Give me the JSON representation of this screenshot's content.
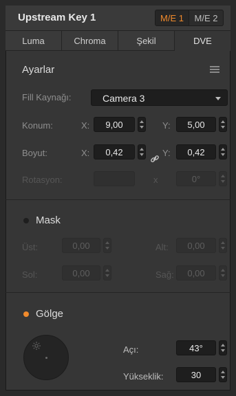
{
  "header": {
    "title": "Upstream Key 1",
    "me_tabs": [
      "M/E 1",
      "M/E 2"
    ]
  },
  "tabs": [
    "Luma",
    "Chroma",
    "Şekil",
    "DVE"
  ],
  "settings": {
    "title": "Ayarlar",
    "fill_label": "Fill Kaynağı:",
    "fill_value": "Camera 3",
    "position_label": "Konum:",
    "size_label": "Boyut:",
    "rotation_label": "Rotasyon:",
    "x_label": "X:",
    "y_label": "Y:",
    "x_dim_label": "x",
    "position_x": "9,00",
    "position_y": "5,00",
    "size_x": "0,42",
    "size_y": "0,42",
    "rotation_value": "0°"
  },
  "mask": {
    "title": "Mask",
    "top_label": "Üst:",
    "top_value": "0,00",
    "bottom_label": "Alt:",
    "bottom_value": "0,00",
    "left_label": "Sol:",
    "left_value": "0,00",
    "right_label": "Sağ:",
    "right_value": "0,00"
  },
  "shadow": {
    "title": "Gölge",
    "angle_label": "Açı:",
    "angle_value": "43°",
    "height_label": "Yükseklik:",
    "height_value": "30"
  },
  "colors": {
    "accent": "#f08a2c",
    "panel": "#363636",
    "field": "#1e1e1e"
  }
}
